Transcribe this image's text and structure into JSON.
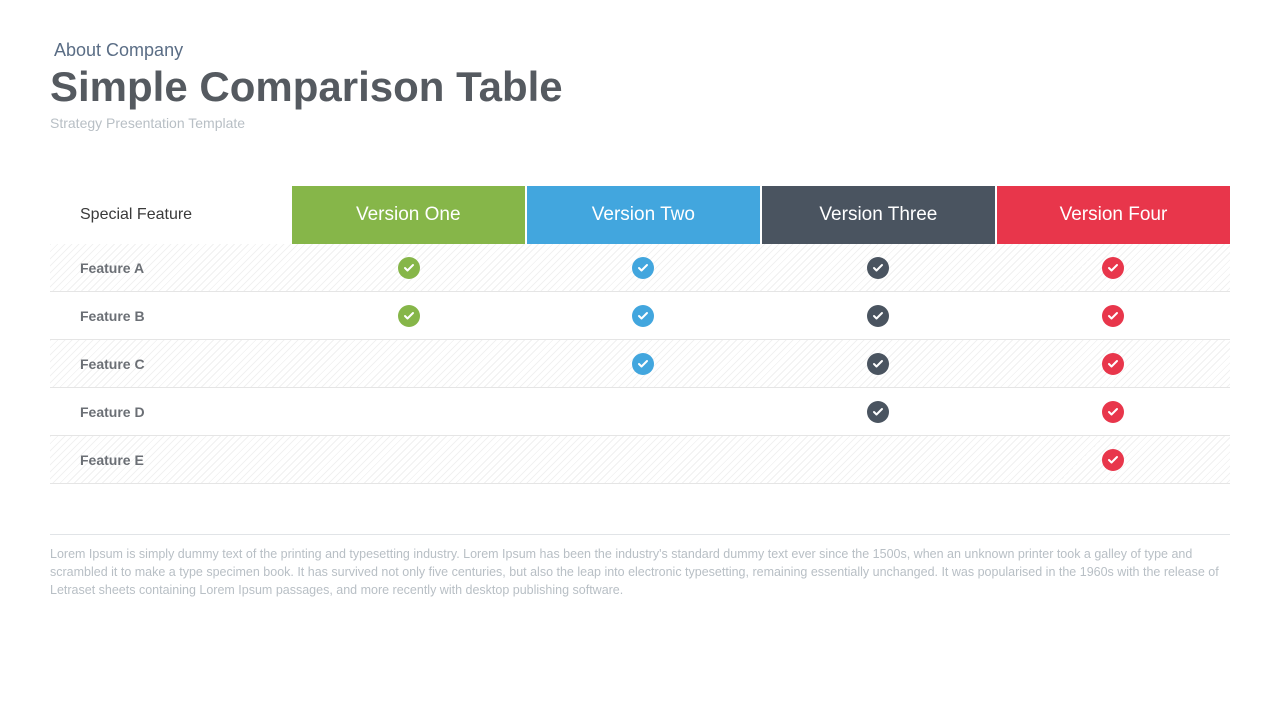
{
  "header": {
    "kicker": "About Company",
    "title": "Simple Comparison Table",
    "subtitle": "Strategy Presentation Template"
  },
  "colors": {
    "v1": "#86b649",
    "v2": "#42a6de",
    "v3": "#4a5460",
    "v4": "#e8364b"
  },
  "table": {
    "feature_col_label": "Special Feature",
    "columns": [
      "Version One",
      "Version Two",
      "Version Three",
      "Version Four"
    ],
    "rows": [
      {
        "label": "Feature A",
        "checks": [
          true,
          true,
          true,
          true
        ]
      },
      {
        "label": "Feature B",
        "checks": [
          true,
          true,
          true,
          true
        ]
      },
      {
        "label": "Feature C",
        "checks": [
          false,
          true,
          true,
          true
        ]
      },
      {
        "label": "Feature D",
        "checks": [
          false,
          false,
          true,
          true
        ]
      },
      {
        "label": "Feature E",
        "checks": [
          false,
          false,
          false,
          true
        ]
      }
    ]
  },
  "footer": "Lorem Ipsum is simply dummy text of the printing and typesetting industry. Lorem Ipsum has been the industry's standard dummy text ever since the 1500s, when an unknown printer took a galley of type and scrambled it to make a type specimen book. It has survived not only five centuries, but also the leap into electronic typesetting, remaining essentially unchanged. It was popularised in the 1960s with the release of Letraset sheets containing Lorem Ipsum passages, and more recently with desktop publishing software."
}
